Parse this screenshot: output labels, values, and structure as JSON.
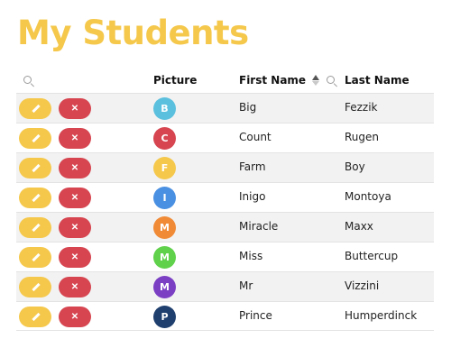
{
  "page": {
    "title": "My Students"
  },
  "table": {
    "headers": {
      "picture": "Picture",
      "first_name": "First Name",
      "last_name": "Last Name"
    },
    "icons": {
      "search": "search-icon",
      "sort": "sort-icon",
      "edit": "pencil-icon",
      "delete": "close-icon"
    },
    "buttons": {
      "delete_label": "✕"
    },
    "colors": {
      "edit": "#f5c84c",
      "delete": "#d64550",
      "title": "#f5c84c"
    },
    "rows": [
      {
        "initial": "B",
        "first": "Big",
        "last": "Fezzik",
        "color": "#5bc0de"
      },
      {
        "initial": "C",
        "first": "Count",
        "last": "Rugen",
        "color": "#d64550"
      },
      {
        "initial": "F",
        "first": "Farm",
        "last": "Boy",
        "color": "#f5c84c"
      },
      {
        "initial": "I",
        "first": "Inigo",
        "last": "Montoya",
        "color": "#4a90e2"
      },
      {
        "initial": "M",
        "first": "Miracle",
        "last": "Maxx",
        "color": "#f08a36"
      },
      {
        "initial": "M",
        "first": "Miss",
        "last": "Buttercup",
        "color": "#5fd14a"
      },
      {
        "initial": "M",
        "first": "Mr",
        "last": "Vizzini",
        "color": "#7b3fc4"
      },
      {
        "initial": "P",
        "first": "Prince",
        "last": "Humperdinck",
        "color": "#1f3f6e"
      }
    ]
  }
}
